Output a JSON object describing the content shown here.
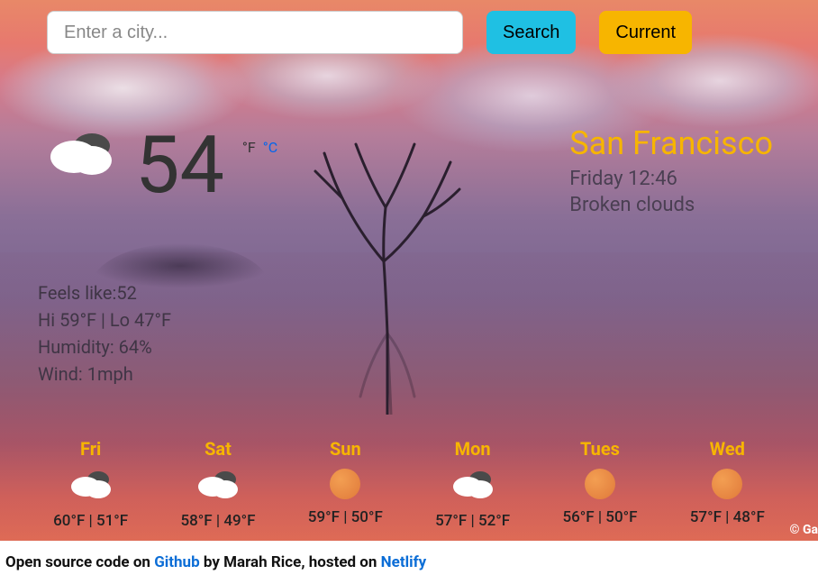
{
  "search": {
    "placeholder": "Enter a city...",
    "search_label": "Search",
    "current_label": "Current"
  },
  "current": {
    "temp": "54",
    "unit_f": "°F",
    "unit_c": "°C",
    "city": "San Francisco",
    "datetime": "Friday 12:46",
    "condition": "Broken clouds",
    "icon": "broken-clouds"
  },
  "details": {
    "feels_like_label": "Feels like:",
    "feels_like_value": "52",
    "hi_lo": "Hi 59°F | Lo 47°F",
    "humidity": "Humidity: 64%",
    "wind": "Wind: 1mph"
  },
  "forecast": [
    {
      "day": "Fri",
      "icon": "broken-clouds",
      "hi": "60°F",
      "lo": "51°F"
    },
    {
      "day": "Sat",
      "icon": "broken-clouds",
      "hi": "58°F",
      "lo": "49°F"
    },
    {
      "day": "Sun",
      "icon": "clear",
      "hi": "59°F",
      "lo": "50°F"
    },
    {
      "day": "Mon",
      "icon": "broken-clouds",
      "hi": "57°F",
      "lo": "52°F"
    },
    {
      "day": "Tues",
      "icon": "clear",
      "hi": "56°F",
      "lo": "50°F"
    },
    {
      "day": "Wed",
      "icon": "clear",
      "hi": "57°F",
      "lo": "48°F"
    }
  ],
  "credit": "© Ga",
  "footer": {
    "prefix": "Open source code on ",
    "link1_label": "Github",
    "middle": " by Marah Rice, hosted on ",
    "link2_label": "Netlify"
  }
}
